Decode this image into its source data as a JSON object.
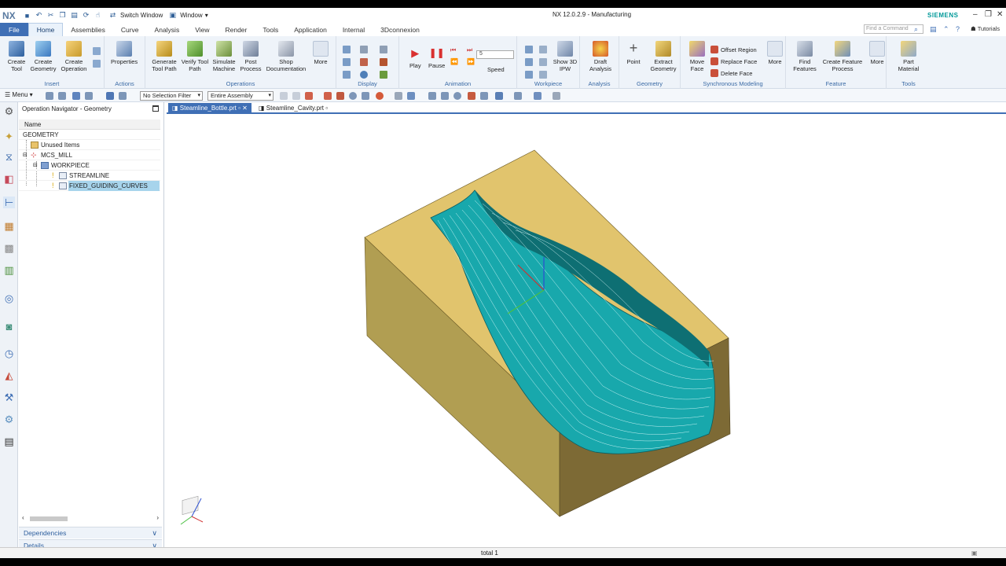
{
  "app": {
    "logo": "NX",
    "title": "NX 12.0.2.9 - Manufacturing",
    "brand": "SIEMENS",
    "accent_color": "#3f6fb5",
    "brand_color": "#009999"
  },
  "quick_access": {
    "switch_window": "Switch Window",
    "window": "Window"
  },
  "menu_tabs": [
    {
      "label": "File"
    },
    {
      "label": "Home"
    },
    {
      "label": "Assemblies"
    },
    {
      "label": "Curve"
    },
    {
      "label": "Analysis"
    },
    {
      "label": "View"
    },
    {
      "label": "Render"
    },
    {
      "label": "Tools"
    },
    {
      "label": "Application"
    },
    {
      "label": "Internal"
    },
    {
      "label": "3Dconnexion"
    }
  ],
  "search": {
    "placeholder": "Find a Command"
  },
  "tutorials": "Tutorials",
  "ribbon": {
    "insert": {
      "label": "Insert",
      "create_tool": "Create Tool",
      "create_geometry": "Create Geometry",
      "create_operation": "Create Operation"
    },
    "actions": {
      "label": "Actions",
      "properties": "Properties"
    },
    "operations": {
      "label": "Operations",
      "generate": "Generate Tool Path",
      "verify": "Verify Tool Path",
      "simulate": "Simulate Machine",
      "post": "Post Process",
      "shop": "Shop Documentation",
      "more": "More"
    },
    "display": {
      "label": "Display"
    },
    "animation": {
      "label": "Animation",
      "play": "Play",
      "pause": "Pause",
      "speed": "Speed",
      "speed_value": "5"
    },
    "workpiece": {
      "label": "Workpiece",
      "show_ipw": "Show 3D IPW"
    },
    "analysis": {
      "label": "Analysis",
      "draft": "Draft Analysis"
    },
    "geometry": {
      "label": "Geometry",
      "point": "Point",
      "extract": "Extract Geometry"
    },
    "sync": {
      "label": "Synchronous Modeling",
      "move_face": "Move Face",
      "offset_region": "Offset Region",
      "replace_face": "Replace Face",
      "delete_face": "Delete Face",
      "more": "More"
    },
    "feature": {
      "label": "Feature",
      "find": "Find Features",
      "create_process": "Create Feature Process",
      "more": "More"
    },
    "tools": {
      "label": "Tools",
      "part_material": "Part Material"
    }
  },
  "toolbar": {
    "menu": "Menu",
    "selection_filter": "No Selection Filter",
    "assembly_scope": "Entire Assembly"
  },
  "navigator": {
    "title": "Operation Navigator - Geometry",
    "column_name": "Name",
    "rows": [
      {
        "label": "GEOMETRY"
      },
      {
        "label": "Unused Items"
      },
      {
        "label": "MCS_MILL"
      },
      {
        "label": "WORKPIECE"
      },
      {
        "label": "STREAMLINE"
      },
      {
        "label": "FIXED_GUIDING_CURVES"
      }
    ],
    "panels": {
      "dependencies": "Dependencies",
      "details": "Details"
    }
  },
  "graphics_tabs": [
    {
      "label": "Steamline_Bottle.prt"
    },
    {
      "label": "Steamline_Cavity.prt"
    }
  ],
  "status": {
    "text": "total 1"
  }
}
